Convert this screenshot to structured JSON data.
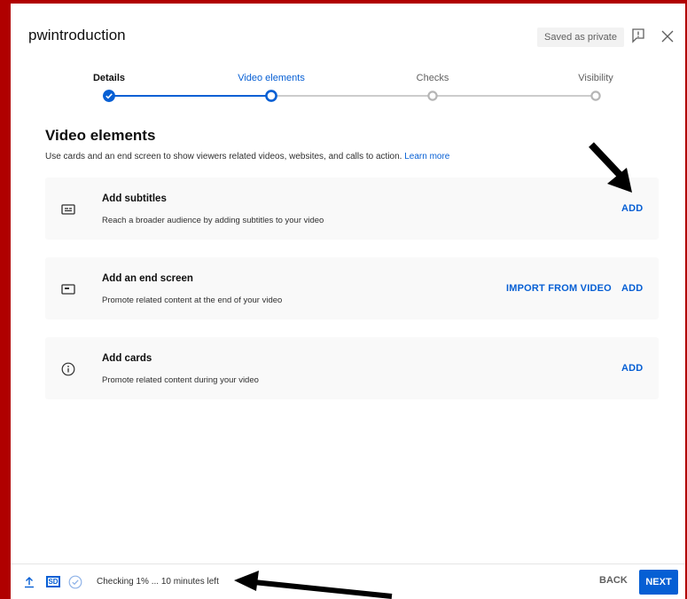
{
  "header": {
    "title": "pwintroduction",
    "saved_badge": "Saved as private"
  },
  "stepper": {
    "steps": [
      {
        "label": "Details",
        "state": "done"
      },
      {
        "label": "Video elements",
        "state": "active"
      },
      {
        "label": "Checks",
        "state": "pending"
      },
      {
        "label": "Visibility",
        "state": "pending"
      }
    ]
  },
  "main": {
    "title": "Video elements",
    "description": "Use cards and an end screen to show viewers related videos, websites, and calls to action.",
    "learn_more": "Learn more",
    "cards": [
      {
        "title": "Add subtitles",
        "description": "Reach a broader audience by adding subtitles to your video",
        "icon": "subtitles-icon",
        "add_label": "ADD"
      },
      {
        "title": "Add an end screen",
        "description": "Promote related content at the end of your video",
        "icon": "end-screen-icon",
        "import_label": "IMPORT FROM VIDEO",
        "add_label": "ADD"
      },
      {
        "title": "Add cards",
        "description": "Promote related content during your video",
        "icon": "info-icon",
        "add_label": "ADD"
      }
    ]
  },
  "footer": {
    "sd_label": "SD",
    "status": "Checking 1% ... 10 minutes left",
    "back_label": "BACK",
    "next_label": "NEXT"
  },
  "colors": {
    "accent": "#065fd4",
    "frame": "#b00000",
    "card_bg": "#f9f9f9"
  }
}
